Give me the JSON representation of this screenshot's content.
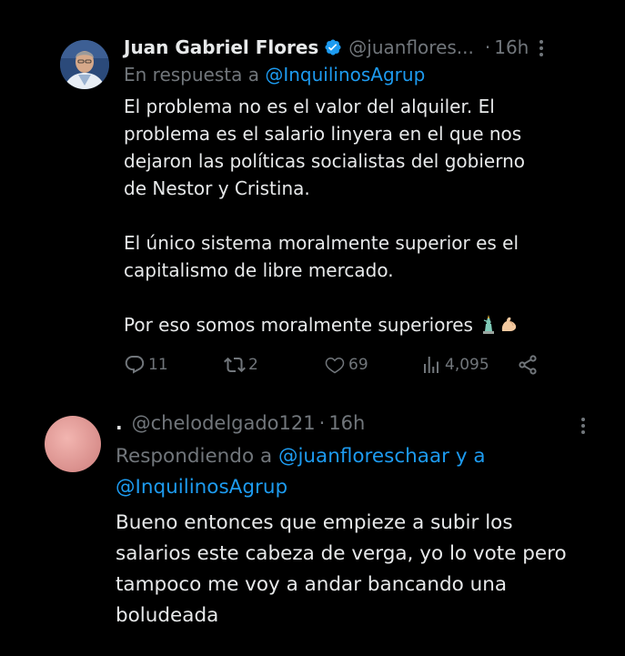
{
  "tweet1": {
    "author_name": "Juan Gabriel Flores",
    "handle": "@juanflores...",
    "separator": "·",
    "time": "16h",
    "reply_prefix": "En respuesta a ",
    "reply_mention": "@InquilinosAgrup",
    "body": "El problema no es el valor del alquiler. El\nproblema es el salario linyera en el que nos\ndejaron las políticas socialistas del gobierno\nde Nestor y Cristina.\n\nEl único sistema moralmente superior es el\ncapitalismo de libre mercado.\n\nPor eso somos moralmente superiores ",
    "emoji_names": [
      "statue-of-liberty-icon",
      "flexed-biceps-icon"
    ],
    "actions": {
      "replies": "11",
      "reposts": "2",
      "likes": "69",
      "views": "4,095"
    }
  },
  "tweet2": {
    "author_name": ".",
    "handle": "@chelodelgado121",
    "separator": "·",
    "time": "16h",
    "reply_prefix": "Respondiendo a ",
    "reply_mention_1": "@juanfloreschaar",
    "reply_joiner": " y a ",
    "reply_mention_2": "@InquilinosAgrup",
    "body": "Bueno entonces que empieze a subir los\nsalarios este cabeza de verga, yo lo vote pero\ntampoco me voy a andar bancando una\nboludeada"
  },
  "colors": {
    "background": "#000000",
    "text": "#e7e9ea",
    "secondary": "#71767b",
    "accent": "#1d9bf0"
  }
}
